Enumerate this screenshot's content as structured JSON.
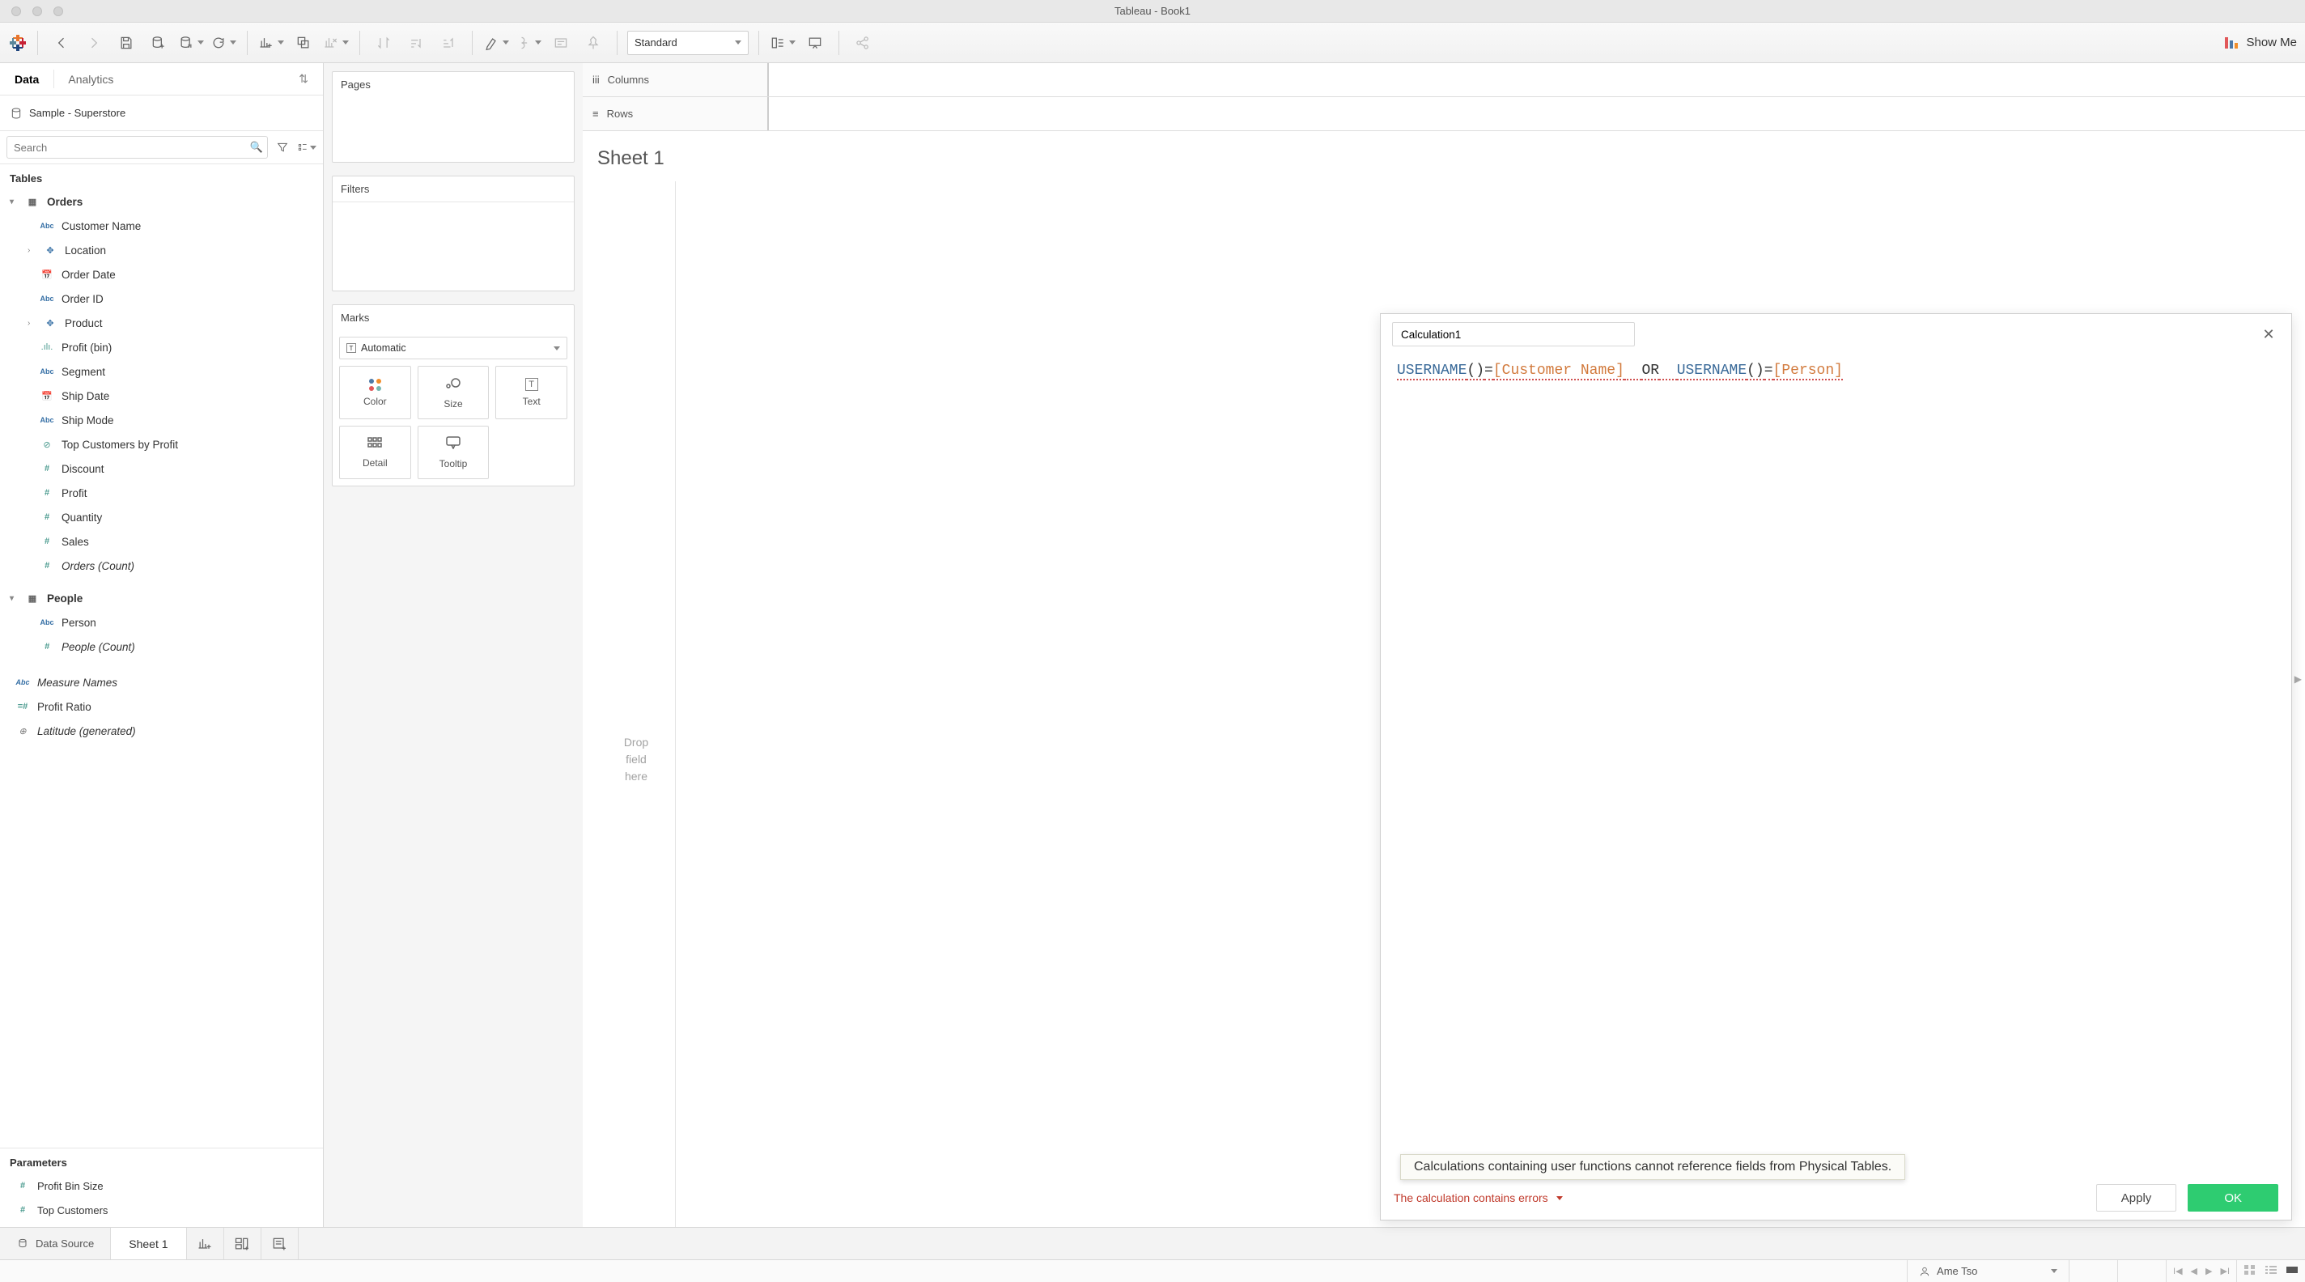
{
  "window": {
    "title": "Tableau - Book1"
  },
  "toolbar": {
    "fit_mode": "Standard",
    "showme": "Show Me"
  },
  "side": {
    "tab_data": "Data",
    "tab_analytics": "Analytics",
    "connection": "Sample - Superstore",
    "search_placeholder": "Search",
    "tables_header": "Tables",
    "params_header": "Parameters"
  },
  "tree": {
    "orders": "Orders",
    "customer_name": "Customer Name",
    "location": "Location",
    "order_date": "Order Date",
    "order_id": "Order ID",
    "product": "Product",
    "profit_bin": "Profit (bin)",
    "segment": "Segment",
    "ship_date": "Ship Date",
    "ship_mode": "Ship Mode",
    "top_customers": "Top Customers by Profit",
    "discount": "Discount",
    "profit": "Profit",
    "quantity": "Quantity",
    "sales": "Sales",
    "orders_count": "Orders (Count)",
    "people": "People",
    "person": "Person",
    "people_count": "People (Count)",
    "measure_names": "Measure Names",
    "profit_ratio": "Profit Ratio",
    "latitude": "Latitude (generated)",
    "param_profit_bin": "Profit Bin Size",
    "param_top_cust": "Top Customers"
  },
  "shelves": {
    "pages": "Pages",
    "filters": "Filters",
    "marks": "Marks",
    "columns": "Columns",
    "rows": "Rows",
    "mark_type": "Automatic",
    "color": "Color",
    "size": "Size",
    "text": "Text",
    "detail": "Detail",
    "tooltip": "Tooltip"
  },
  "canvas": {
    "sheet_title": "Sheet 1",
    "drop1": "Drop",
    "drop2": "field",
    "drop3": "here"
  },
  "calc": {
    "name": "Calculation1",
    "fn1": "USERNAME",
    "paren": "()",
    "eq": "=",
    "field1": "[Customer Name]",
    "or": "OR",
    "fn2": "USERNAME",
    "field2": "[Person]",
    "error": "The calculation contains errors",
    "tooltip": "Calculations containing user functions cannot reference fields from Physical Tables.",
    "apply": "Apply",
    "ok": "OK"
  },
  "tabs": {
    "data_source": "Data Source",
    "sheet1": "Sheet 1"
  },
  "status": {
    "user": "Ame Tso"
  }
}
